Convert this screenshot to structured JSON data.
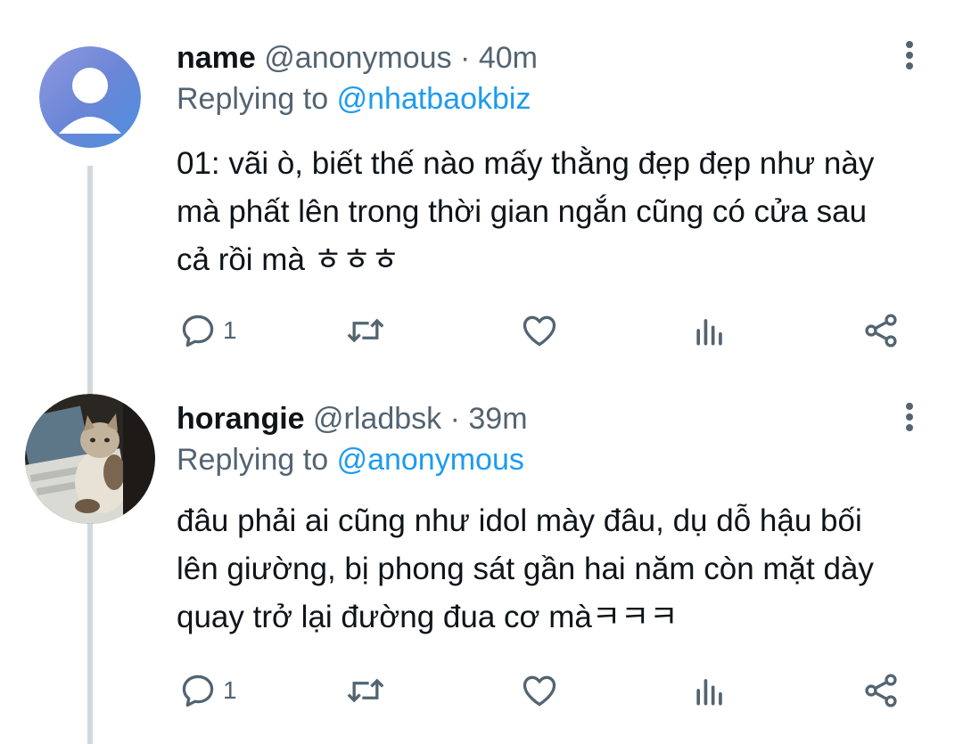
{
  "tweets": [
    {
      "name": "name",
      "handle": "@anonymous",
      "separator": "·",
      "time": "40m",
      "replying_prefix": "Replying to",
      "replying_to": "@nhatbaokbiz",
      "text_lines": [
        "01: vãi ò, biết thế nào mấy thằng đẹp đẹp như này",
        "mà phất lên trong thời gian ngắn cũng có cửa sau",
        "cả rồi mà ㅎㅎㅎ"
      ],
      "reply_count": "1",
      "avatar_icon": "default-user-avatar",
      "icons": [
        "reply-icon",
        "retweet-icon",
        "like-icon",
        "analytics-icon",
        "share-icon",
        "more-icon"
      ]
    },
    {
      "name": "horangie",
      "handle": "@rladbsk",
      "separator": "·",
      "time": "39m",
      "replying_prefix": "Replying to",
      "replying_to": "@anonymous",
      "text_lines": [
        "đâu phải ai cũng như idol mày đâu, dụ dỗ hậu bối",
        "lên giường, bị phong sát gần hai năm còn mặt dày",
        "quay trở lại đường đua cơ màㅋㅋㅋ"
      ],
      "reply_count": "1",
      "avatar_icon": "cat-photo-avatar",
      "icons": [
        "reply-icon",
        "retweet-icon",
        "like-icon",
        "analytics-icon",
        "share-icon",
        "more-icon"
      ]
    }
  ],
  "colors": {
    "text": "#0f1419",
    "secondary": "#536471",
    "mention": "#1d9bf0",
    "thread_line": "#cfd9de"
  }
}
